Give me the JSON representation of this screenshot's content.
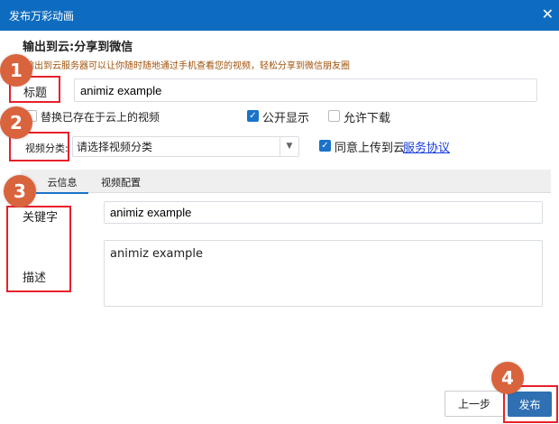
{
  "window": {
    "title": "发布万彩动画",
    "close_icon": "close-icon"
  },
  "heading": "输出到云:分享到微信",
  "hint": "输出到云服务器可以让你随时随地通过手机查看您的视频，轻松分享到微信朋友圈",
  "fields": {
    "title_label": "标题",
    "title_value": "animiz example",
    "replace_label": "替换已存在于云上的视频",
    "replace_checked": false,
    "public_label": "公开显示",
    "public_checked": true,
    "download_label": "允许下载",
    "download_checked": false,
    "category_label": "视频分类:",
    "category_value": "请选择视频分类",
    "agree_label": "同意上传到云",
    "agree_link": "服务协议",
    "agree_checked": true
  },
  "tabs": [
    {
      "label": "云信息",
      "active": true
    },
    {
      "label": "视频配置",
      "active": false
    }
  ],
  "cloud": {
    "keyword_label": "关键字",
    "keyword_value": "animiz example",
    "desc_label": "描述",
    "desc_value": "animiz example"
  },
  "buttons": {
    "prev": "上一步",
    "publish": "发布"
  },
  "badges": [
    "1",
    "2",
    "3",
    "4"
  ],
  "colors": {
    "accent": "#0e6cc0",
    "badge": "#d9633d",
    "highlight": "#e8202a"
  }
}
